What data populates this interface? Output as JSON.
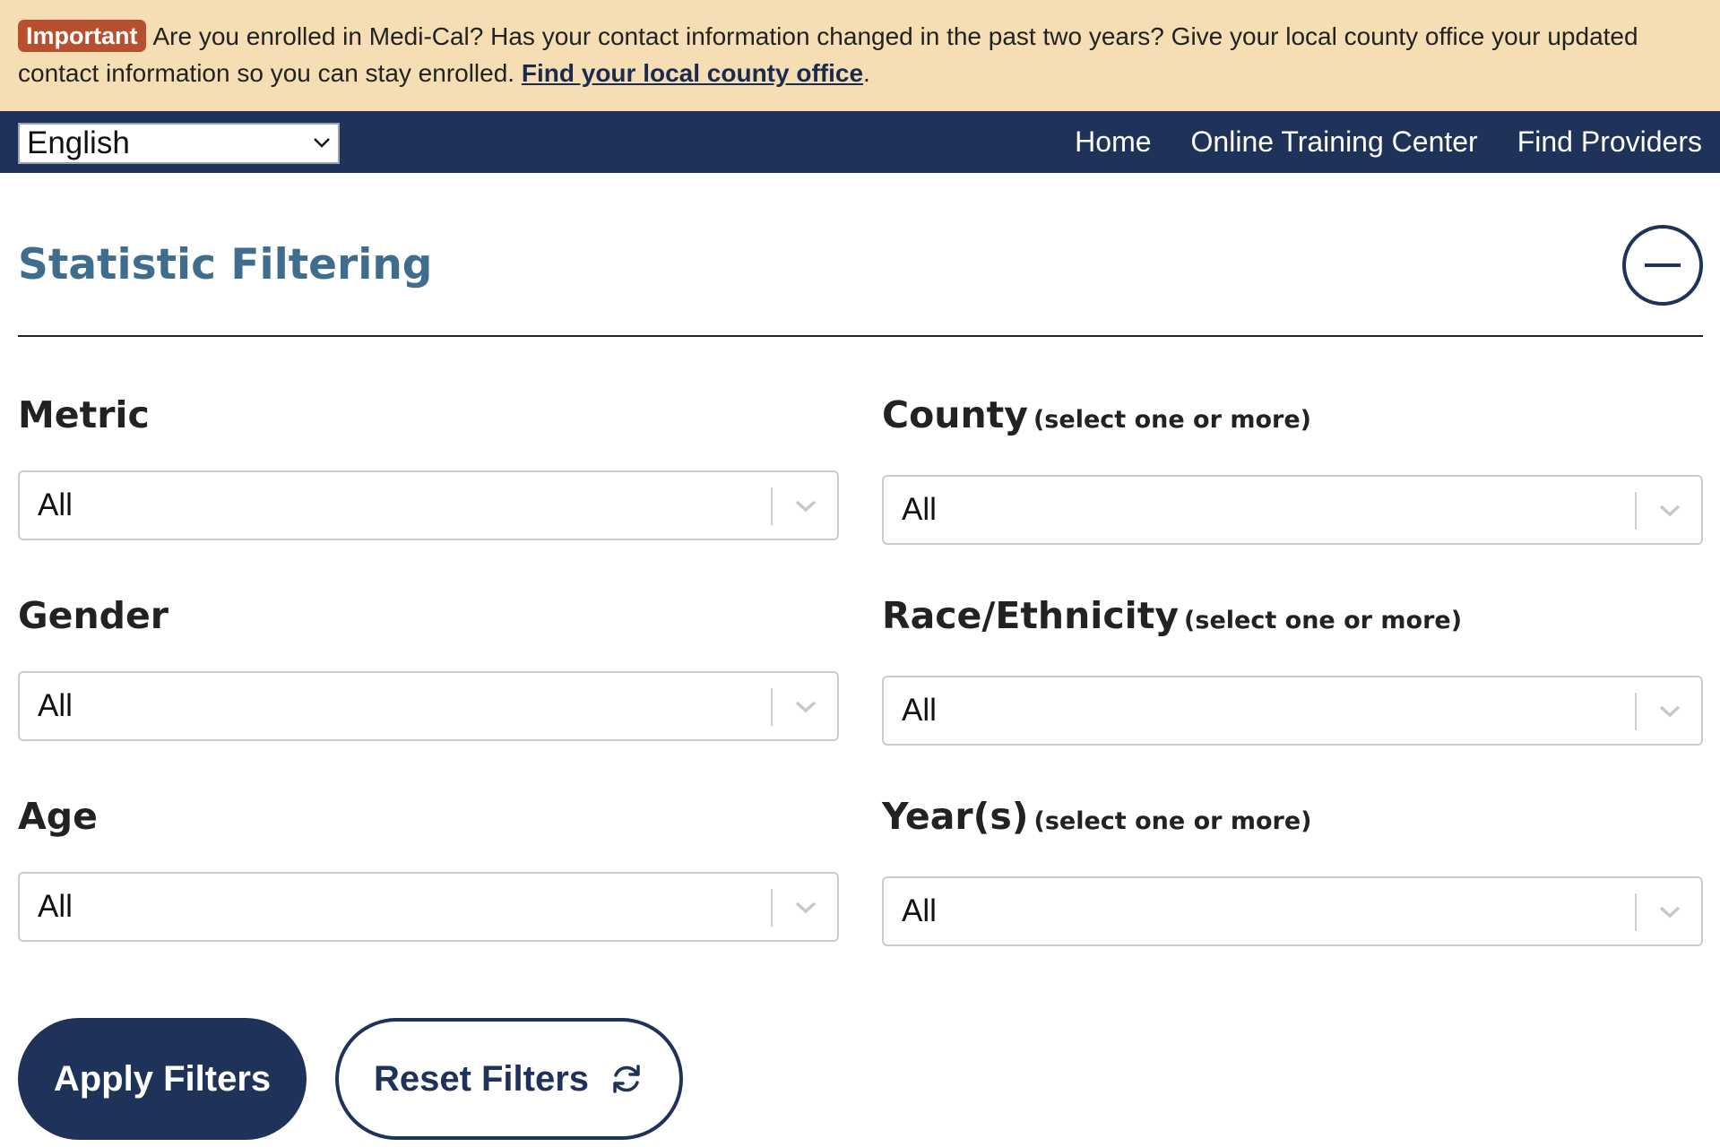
{
  "banner": {
    "badge": "Important",
    "message": "Are you enrolled in Medi-Cal? Has your contact information changed in the past two years? Give your local county office your updated contact information so you can stay enrolled.",
    "link": "Find your local county office",
    "trailing": "."
  },
  "nav": {
    "language": "English",
    "links": [
      "Home",
      "Online Training Center",
      "Find Providers"
    ]
  },
  "section": {
    "title": "Statistic Filtering"
  },
  "filters": {
    "metric": {
      "label": "Metric",
      "hint": "",
      "value": "All"
    },
    "gender": {
      "label": "Gender",
      "hint": "",
      "value": "All"
    },
    "age": {
      "label": "Age",
      "hint": "",
      "value": "All"
    },
    "county": {
      "label": "County",
      "hint": "(select one or more)",
      "value": "All"
    },
    "race": {
      "label": "Race/Ethnicity",
      "hint": "(select one or more)",
      "value": "All"
    },
    "years": {
      "label": "Year(s)",
      "hint": "(select one or more)",
      "value": "All"
    }
  },
  "buttons": {
    "apply": "Apply Filters",
    "reset": "Reset Filters"
  },
  "icons": {
    "collapse": "minus-circle-icon",
    "reset": "refresh-icon",
    "dropdown": "chevron-down-icon"
  },
  "colors": {
    "banner_bg": "#f5deb3",
    "badge_bg": "#b7502e",
    "nav_bg": "#1f3259",
    "title": "#3e6d8e",
    "primary": "#1f3259"
  }
}
